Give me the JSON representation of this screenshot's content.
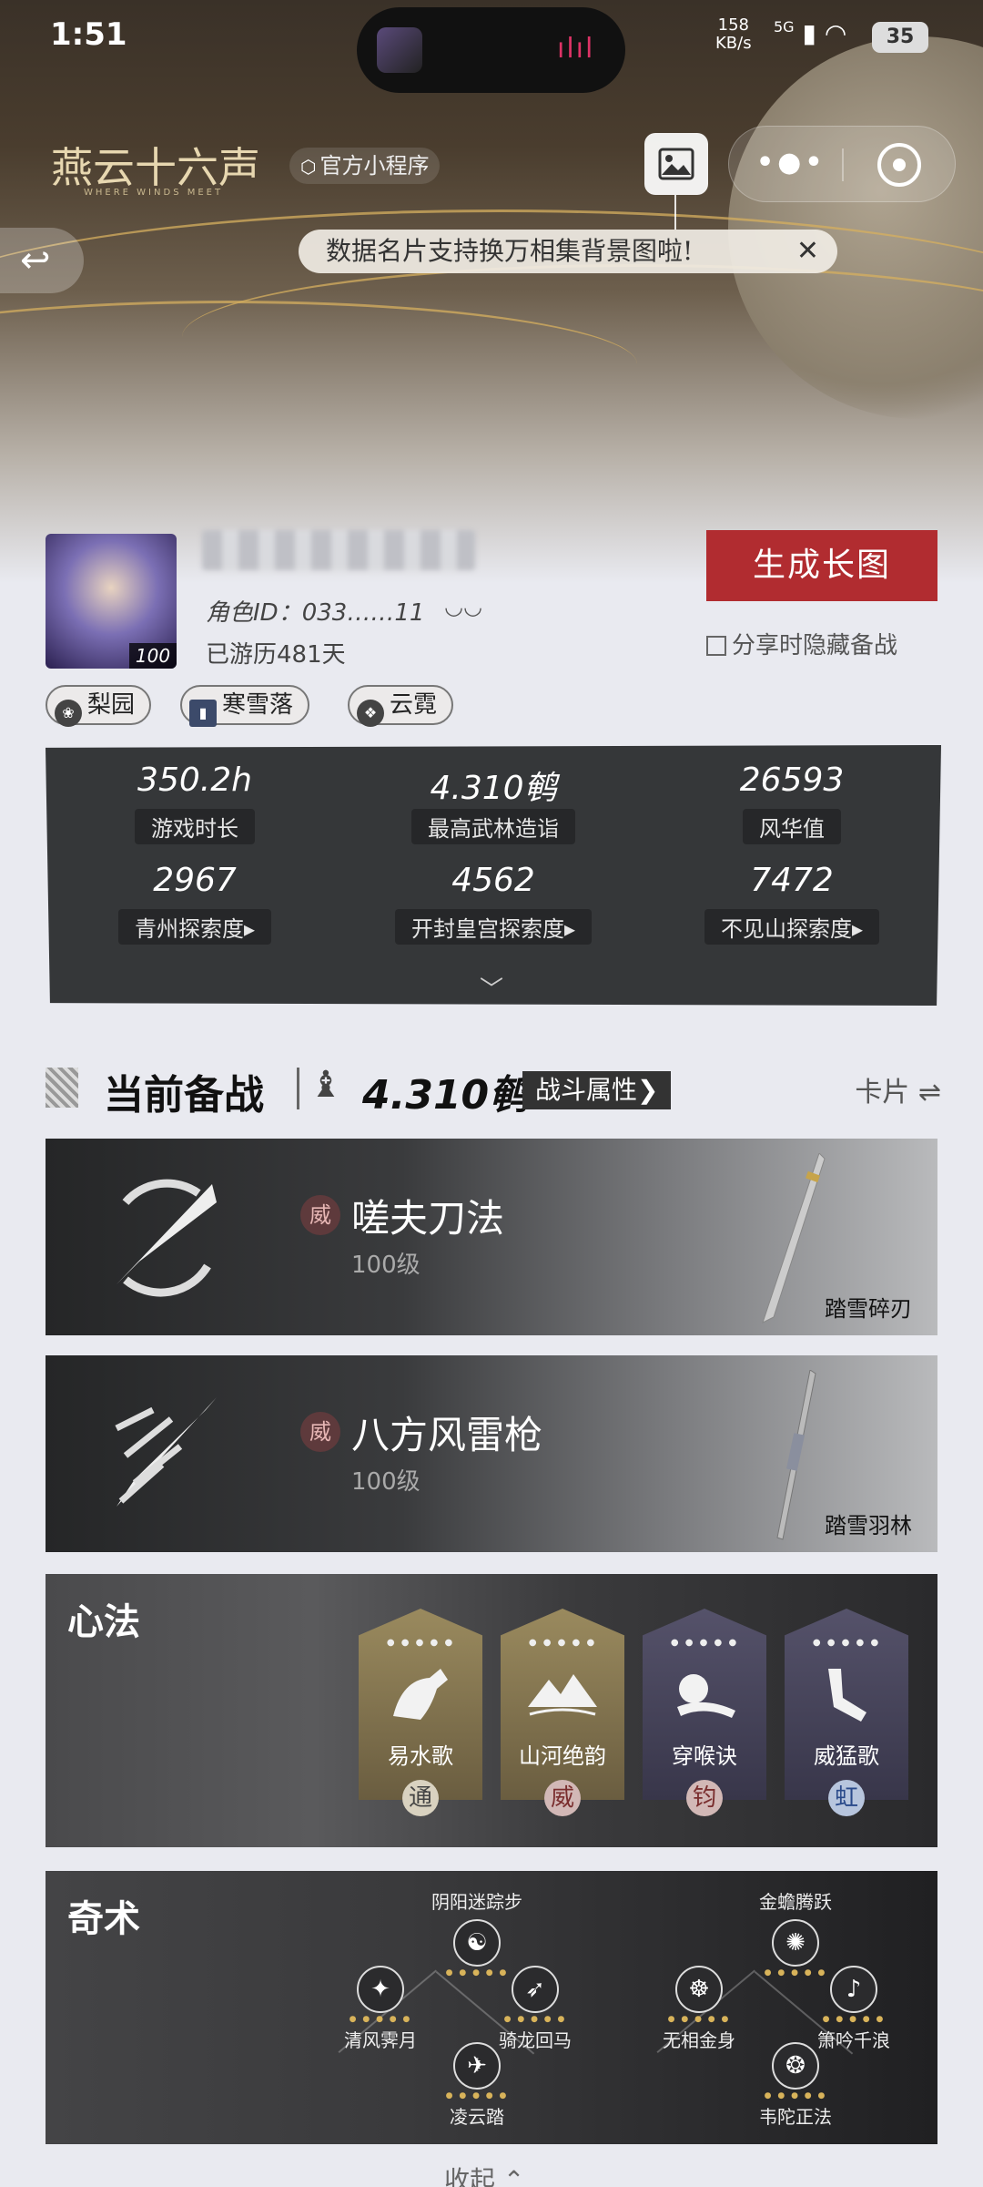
{
  "status": {
    "time": "1:51",
    "net_speed": "158",
    "net_unit": "KB/s",
    "signal": "5G",
    "battery": "35"
  },
  "header": {
    "logo_text": "燕云十六声",
    "logo_sub": "WHERE WINDS MEET",
    "mini_program_label": "官方小程序",
    "tooltip_text": "数据名片支持换万相集背景图啦!",
    "tooltip_close": "✕"
  },
  "profile": {
    "avatar_level": "100",
    "role_id": "角色ID：033……11",
    "days": "已游历481天",
    "generate_button": "生成长图",
    "hide_share_label": "分享时隐藏备战",
    "tags": [
      "梨园",
      "寒雪落",
      "云霓"
    ]
  },
  "stats": {
    "items": [
      {
        "value": "350.2h",
        "label": "游戏时长"
      },
      {
        "value": "4.310鹌",
        "label": "最高武林造诣"
      },
      {
        "value": "26593",
        "label": "风华值"
      },
      {
        "value": "2967",
        "label": "青州探索度▸"
      },
      {
        "value": "4562",
        "label": "开封皇宫探索度▸"
      },
      {
        "value": "7472",
        "label": "不见山探索度▸"
      }
    ],
    "expand_icon": "chevron-down-icon"
  },
  "loadout": {
    "title": "当前备战",
    "score": "4.310鹌",
    "attr_button": "战斗属性❯",
    "card_toggle": "卡片 ⇌"
  },
  "weapons": [
    {
      "badge": "威",
      "name": "嗟夫刀法",
      "level": "100级",
      "weapon": "踏雪碎刃"
    },
    {
      "badge": "威",
      "name": "八方风雷枪",
      "level": "100级",
      "weapon": "踏雪羽林"
    }
  ],
  "xinfa": {
    "title": "心法",
    "items": [
      {
        "name": "易水歌",
        "seal": "通",
        "bg": "#8a7a52",
        "seal_bg": "#d9d2c0",
        "seal_color": "#444"
      },
      {
        "name": "山河绝韵",
        "seal": "威",
        "bg": "#8a7a52",
        "seal_bg": "#d2b8b6",
        "seal_color": "#7a2e2e"
      },
      {
        "name": "穿喉诀",
        "seal": "钧",
        "bg": "#4b4858",
        "seal_bg": "#d2b8b6",
        "seal_color": "#7a2e2e"
      },
      {
        "name": "威猛歌",
        "seal": "虹",
        "bg": "#4b4858",
        "seal_bg": "#b7c5dd",
        "seal_color": "#2a4a8a"
      }
    ]
  },
  "qishu": {
    "title": "奇术",
    "nodes": [
      {
        "name": "阴阳迷踪步",
        "icon": "☯"
      },
      {
        "name": "清风霁月",
        "icon": "✦"
      },
      {
        "name": "骑龙回马",
        "icon": "➶"
      },
      {
        "name": "凌云踏",
        "icon": "✈"
      },
      {
        "name": "金蟾腾跃",
        "icon": "✺"
      },
      {
        "name": "无相金身",
        "icon": "☸"
      },
      {
        "name": "箫吟千浪",
        "icon": "♪"
      },
      {
        "name": "韦陀正法",
        "icon": "❂"
      }
    ]
  },
  "collapse_label": "收起 ⌃"
}
